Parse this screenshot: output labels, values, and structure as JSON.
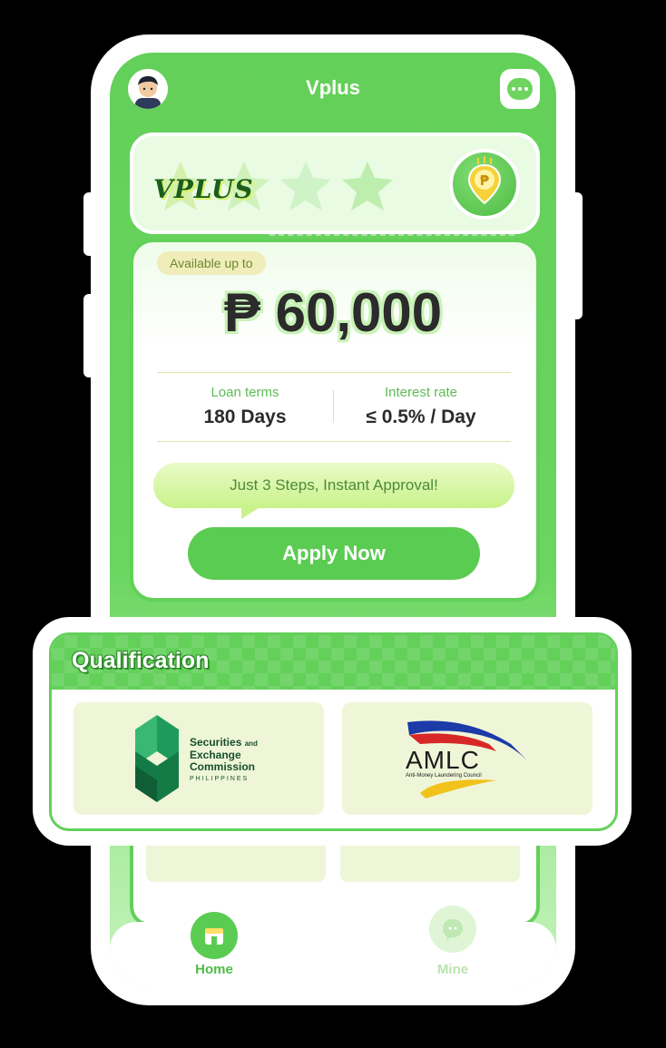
{
  "app": {
    "title": "Vplus"
  },
  "hero": {
    "brand": "VPLUS",
    "available_label": "Available up to",
    "amount": "₱ 60,000",
    "loan_terms_label": "Loan terms",
    "loan_terms_value": "180 Days",
    "interest_label": "Interest rate",
    "interest_value": "≤ 0.5% / Day",
    "steps_text": "Just 3 Steps, Instant Approval!",
    "apply_label": "Apply Now"
  },
  "qualification": {
    "title": "Qualification",
    "sec": {
      "line1": "Securities",
      "line1_small": "and",
      "line2": "Exchange",
      "line3": "Commission",
      "line4": "PHILIPPINES"
    },
    "amlc": {
      "name": "AMLC",
      "subtitle": "Anti-Money Laundering Council"
    }
  },
  "tabs": [
    {
      "label": "Home",
      "active": true
    },
    {
      "label": "Mine",
      "active": false
    }
  ],
  "colors": {
    "primary": "#63d05a",
    "dark_text": "#2b2b2b",
    "brand_dark": "#1a5e1a"
  }
}
